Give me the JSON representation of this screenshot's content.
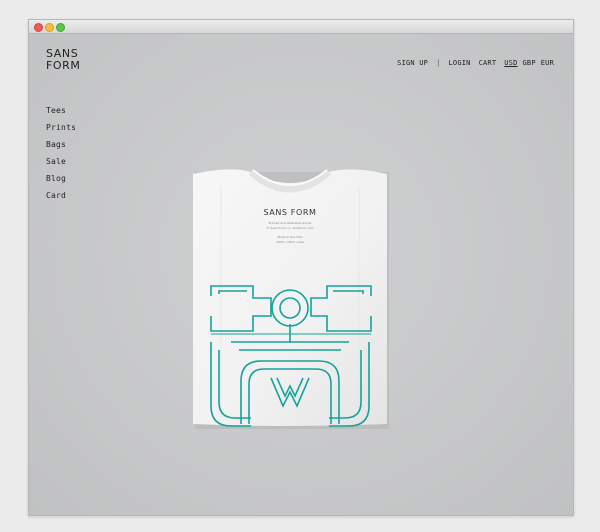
{
  "window": {
    "controls": [
      "close",
      "minimize",
      "zoom"
    ]
  },
  "header": {
    "logo": "SANS\nFORM",
    "nav": {
      "sign_up": "SIGN UP",
      "separator": "|",
      "login": "LOGIN",
      "cart": "CART"
    },
    "currencies": [
      {
        "label": "USD",
        "selected": true
      },
      {
        "label": "GBP",
        "selected": false
      },
      {
        "label": "EUR",
        "selected": false
      }
    ]
  },
  "sidebar": {
    "items": [
      {
        "label": "Tees"
      },
      {
        "label": "Prints"
      },
      {
        "label": "Bags"
      },
      {
        "label": "Sale"
      },
      {
        "label": "Blog"
      },
      {
        "label": "Card"
      }
    ]
  },
  "product": {
    "neck_label": "SANS FORM",
    "tag_line_1": "Printed and Wearable Goods",
    "tag_line_2": "© Sans Form co. sansform.com",
    "tag_line_3": "Made in the USA",
    "tag_line_4": "100% cotton / size",
    "print_color": "#14a39a"
  }
}
